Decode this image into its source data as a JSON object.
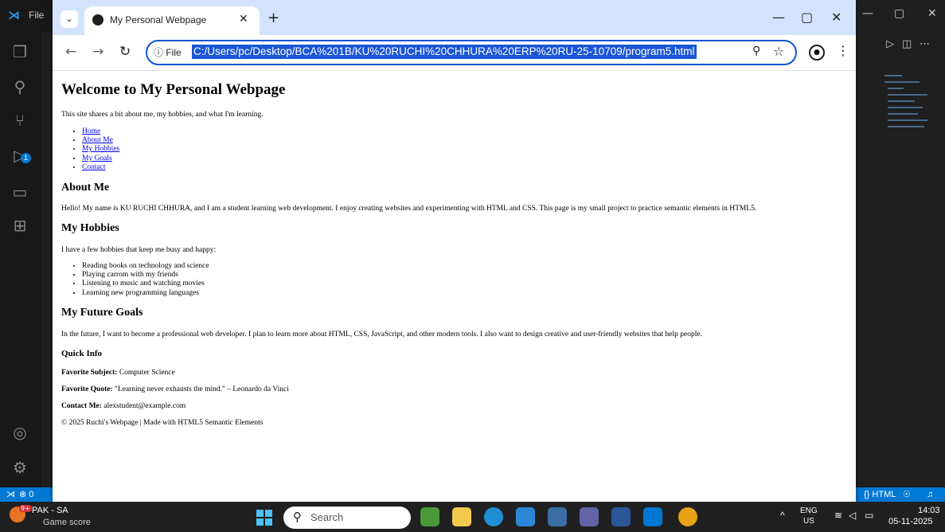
{
  "vscode": {
    "menu_label": "File",
    "status_errors": "⊗ 0",
    "status_language": "{} HTML",
    "activity_badge": "1"
  },
  "browser": {
    "tab_title": "My Personal Webpage",
    "omnibox_info": "ⓘ File",
    "url": "C:/Users/pc/Desktop/BCA%201B/KU%20RUCHI%20CHHURA%20ERP%20RU-25-10709/program5.html"
  },
  "page": {
    "h1": "Welcome to My Personal Webpage",
    "intro": "This site shares a bit about me, my hobbies, and what I'm learning.",
    "nav_links": [
      "Home",
      "About Me",
      "My Hobbies",
      "My Goals",
      "Contact"
    ],
    "about_heading": "About Me",
    "about_text": "Hello! My name is KU RUCHI CHHURA, and I am a student learning web development. I enjoy creating websites and experimenting with HTML and CSS. This page is my small project to practice semantic elements in HTML5.",
    "hobbies_heading": "My Hobbies",
    "hobbies_intro": "I have a few hobbies that keep me busy and happy:",
    "hobbies": [
      "Reading books on technology and science",
      "Playing carrom with my friends",
      "Listening to music and watching movies",
      "Learning new programming languages"
    ],
    "goals_heading": "My Future Goals",
    "goals_text": "In the future, I want to become a professional web developer. I plan to learn more about HTML, CSS, JavaScript, and other modern tools. I also want to design creative and user-friendly websites that help people.",
    "quick_heading": "Quick Info",
    "subject_label": "Favorite Subject:",
    "subject_value": " Computer Science",
    "quote_label": "Favorite Quote:",
    "quote_value": " \"Learning never exhausts the mind.\" – Leonardo da Vinci",
    "contact_label": "Contact Me:",
    "contact_value": " alexstudent@example.com",
    "footer": "© 2025 Ruchi's Webpage | Made with HTML5 Semantic Elements"
  },
  "taskbar": {
    "weather_badge": "9+",
    "weather_title": "PAK - SA",
    "weather_sub": "Game score",
    "search_label": "Search",
    "lang_top": "ENG",
    "lang_bottom": "US",
    "time": "14:03",
    "date": "05-11-2025"
  }
}
